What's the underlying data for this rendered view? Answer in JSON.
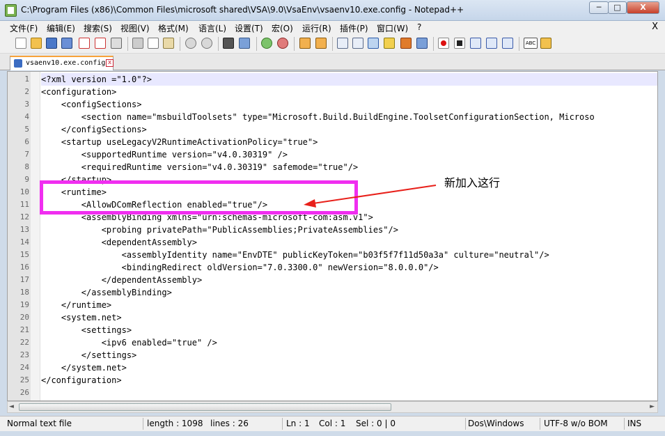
{
  "window": {
    "title": "C:\\Program Files (x86)\\Common Files\\microsoft shared\\VSA\\9.0\\VsaEnv\\vsaenv10.exe.config - Notepad++",
    "min_label": "─",
    "max_label": "□",
    "close_label": "X"
  },
  "menu": {
    "items": [
      "文件(F)",
      "编辑(E)",
      "搜索(S)",
      "视图(V)",
      "格式(M)",
      "语言(L)",
      "设置(T)",
      "宏(O)",
      "运行(R)",
      "插件(P)",
      "窗口(W)",
      "?"
    ],
    "close_label": "X"
  },
  "toolbar": {
    "icons": [
      "new-file-icon",
      "open-file-icon",
      "save-icon",
      "save-all-icon",
      "close-file-icon",
      "close-all-icon",
      "print-icon",
      "cut-icon",
      "copy-icon",
      "paste-icon",
      "undo-icon",
      "redo-icon",
      "find-icon",
      "replace-icon",
      "zoom-in-icon",
      "zoom-out-icon",
      "sync-v-icon",
      "sync-h-icon",
      "wrap-icon",
      "all-chars-icon",
      "indent-guide-icon",
      "doc-map-icon",
      "function-list-icon",
      "folder-workspace-icon",
      "record-macro-icon",
      "stop-macro-icon",
      "play-macro-icon",
      "run-macro-multiple-icon",
      "save-macro-icon",
      "spellcheck-icon",
      "plugin-icon"
    ]
  },
  "tab": {
    "label": "vsaenv10.exe.config",
    "close_label": "x"
  },
  "editor": {
    "lines": [
      "<?xml version =\"1.0\"?>",
      "<configuration>",
      "    <configSections>",
      "        <section name=\"msbuildToolsets\" type=\"Microsoft.Build.BuildEngine.ToolsetConfigurationSection, Microso",
      "    </configSections>",
      "    <startup useLegacyV2RuntimeActivationPolicy=\"true\">",
      "        <supportedRuntime version=\"v4.0.30319\" />",
      "        <requiredRuntime version=\"v4.0.30319\" safemode=\"true\"/>",
      "    </startup>",
      "    <runtime>",
      "        <AllowDComReflection enabled=\"true\"/>",
      "        <assemblyBinding xmlns=\"urn:schemas-microsoft-com:asm.v1\">",
      "            <probing privatePath=\"PublicAssemblies;PrivateAssemblies\"/>",
      "            <dependentAssembly>",
      "                <assemblyIdentity name=\"EnvDTE\" publicKeyToken=\"b03f5f7f11d50a3a\" culture=\"neutral\"/>",
      "                <bindingRedirect oldVersion=\"7.0.3300.0\" newVersion=\"8.0.0.0\"/>",
      "            </dependentAssembly>",
      "        </assemblyBinding>",
      "    </runtime>",
      "    <system.net>",
      "        <settings>",
      "            <ipv6 enabled=\"true\" />",
      "        </settings>",
      "    </system.net>",
      "</configuration>",
      ""
    ],
    "line_numbers": [
      "1",
      "2",
      "3",
      "4",
      "5",
      "6",
      "7",
      "8",
      "9",
      "10",
      "11",
      "12",
      "13",
      "14",
      "15",
      "16",
      "17",
      "18",
      "19",
      "20",
      "21",
      "22",
      "23",
      "24",
      "25",
      "26"
    ]
  },
  "scrollbar": {
    "left_arrow": "◄",
    "right_arrow": "►"
  },
  "status": {
    "type": "Normal text file",
    "length": "length : 1098",
    "lines": "lines : 26",
    "ln": "Ln : 1",
    "col": "Col : 1",
    "sel": "Sel : 0 | 0",
    "eol": "Dos\\Windows",
    "encoding": "UTF-8 w/o BOM",
    "mode": "INS"
  },
  "annotation": {
    "text": "新加入这行",
    "color": "#f02ef0",
    "arrow_color": "#e8201a"
  },
  "colors": {
    "highlight_line": "#e8e8ff",
    "tab_accent": "#f7a23b"
  }
}
